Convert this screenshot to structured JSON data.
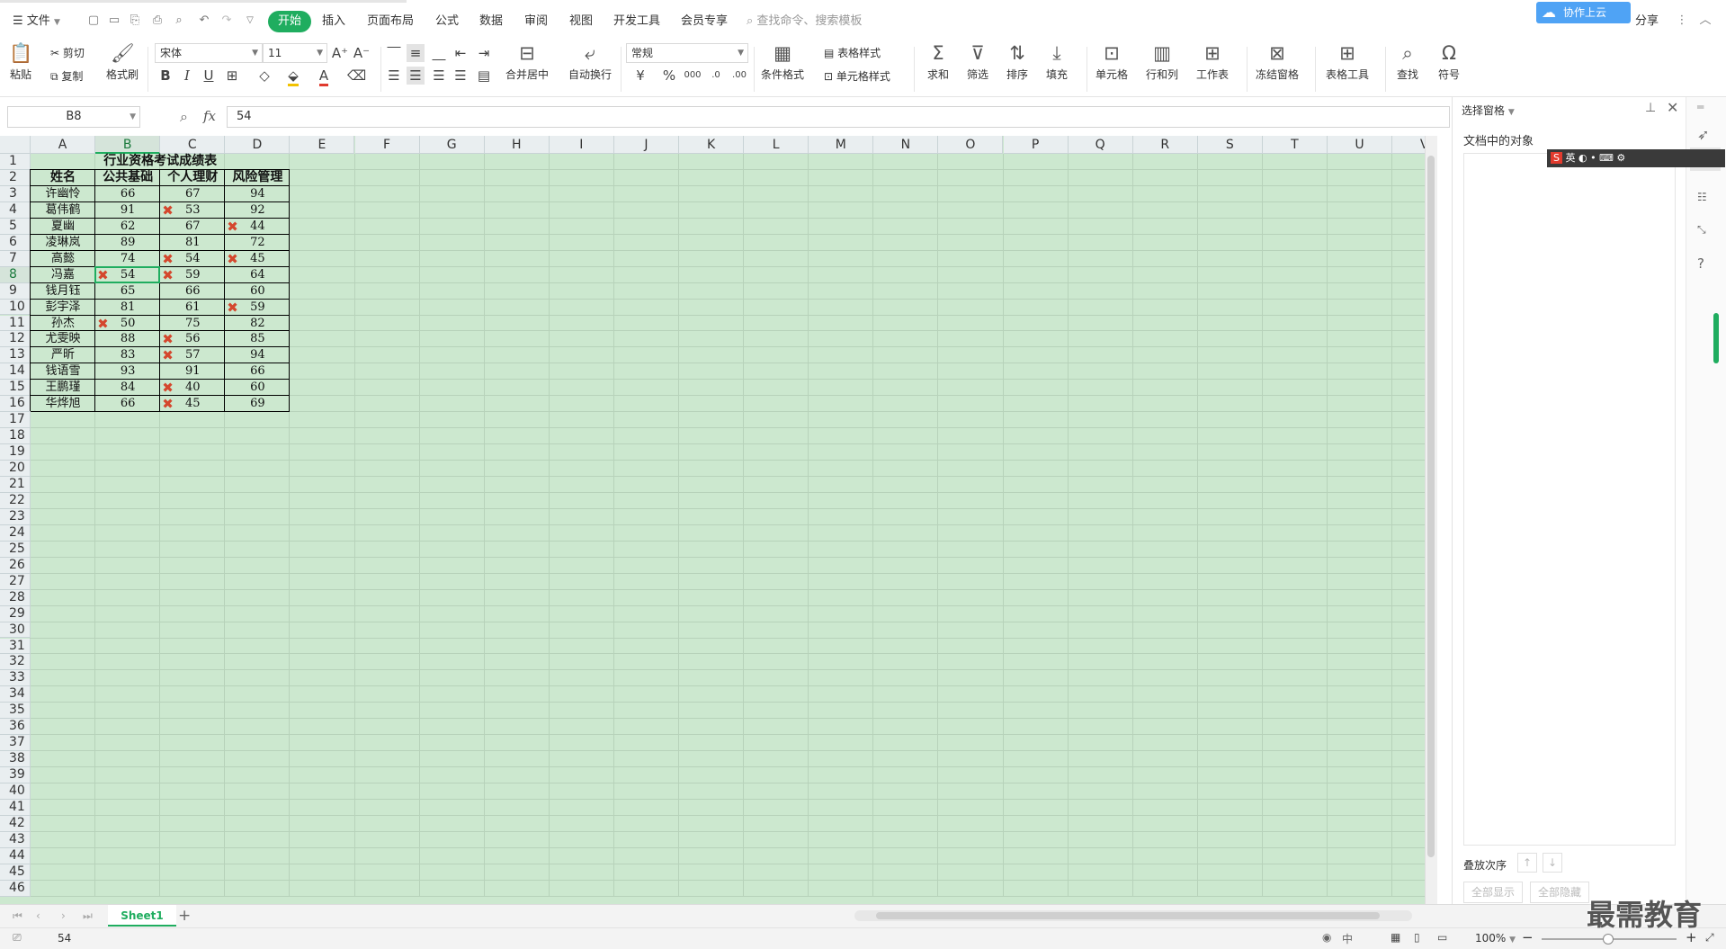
{
  "menu": {
    "file_label": "文件",
    "tabs": [
      {
        "label": "开始",
        "active": true
      },
      {
        "label": "插入"
      },
      {
        "label": "页面布局"
      },
      {
        "label": "公式"
      },
      {
        "label": "数据"
      },
      {
        "label": "审阅"
      },
      {
        "label": "视图"
      },
      {
        "label": "开发工具"
      },
      {
        "label": "会员专享"
      }
    ],
    "search_placeholder": "查找命令、搜索模板",
    "share_label": "分享",
    "cloud_label": "协作上云"
  },
  "ribbon": {
    "paste": "粘贴",
    "cut": "剪切",
    "copy": "复制",
    "format_painter": "格式刷",
    "font_name": "宋体",
    "font_size": "11",
    "merge_center": "合并居中",
    "wrap_text": "自动换行",
    "number_format": "常规",
    "conditional_format": "条件格式",
    "table_style": "表格样式",
    "cell_style": "单元格样式",
    "sum": "求和",
    "filter": "筛选",
    "sort": "排序",
    "fill": "填充",
    "cell": "单元格",
    "row_col": "行和列",
    "worksheet": "工作表",
    "freeze": "冻结窗格",
    "table_tools": "表格工具",
    "find": "查找",
    "symbol": "符号"
  },
  "formula_bar": {
    "name_box": "B8",
    "fx": "fx",
    "value": "54"
  },
  "columns": [
    "A",
    "B",
    "C",
    "D",
    "E",
    "F",
    "G",
    "H",
    "I",
    "J",
    "K",
    "L",
    "M",
    "N",
    "O",
    "P",
    "Q",
    "R",
    "S",
    "T",
    "U",
    "V"
  ],
  "selected_column": "B",
  "selected_row": 8,
  "table": {
    "title": "行业资格考试成绩表",
    "headers": [
      "姓名",
      "公共基础",
      "个人理财",
      "风险管理"
    ],
    "rows": [
      [
        "许幽怜",
        "66",
        "67",
        "94"
      ],
      [
        "葛伟鹤",
        "91",
        "53",
        "92"
      ],
      [
        "夏幽",
        "62",
        "67",
        "44"
      ],
      [
        "凌琳岚",
        "89",
        "81",
        "72"
      ],
      [
        "高懿",
        "74",
        "54",
        "45"
      ],
      [
        "冯嘉",
        "54",
        "59",
        "64"
      ],
      [
        "钱月钰",
        "65",
        "66",
        "60"
      ],
      [
        "彭宇泽",
        "81",
        "61",
        "59"
      ],
      [
        "孙杰",
        "50",
        "75",
        "82"
      ],
      [
        "尤雯映",
        "88",
        "56",
        "85"
      ],
      [
        "严昕",
        "83",
        "57",
        "94"
      ],
      [
        "钱语雪",
        "93",
        "91",
        "66"
      ],
      [
        "王鹏瑾",
        "84",
        "40",
        "60"
      ],
      [
        "华烨旭",
        "66",
        "45",
        "69"
      ]
    ],
    "failed_marks": [
      [
        1,
        2
      ],
      [
        2,
        3
      ],
      [
        4,
        2
      ],
      [
        4,
        3
      ],
      [
        5,
        1
      ],
      [
        5,
        2
      ],
      [
        7,
        3
      ],
      [
        8,
        1
      ],
      [
        9,
        2
      ],
      [
        10,
        2
      ],
      [
        12,
        2
      ],
      [
        13,
        2
      ]
    ]
  },
  "right_pane": {
    "title": "选择窗格",
    "subtitle": "文档中的对象",
    "stack_order": "叠放次序",
    "show_all": "全部显示",
    "hide_all": "全部隐藏"
  },
  "sheet_tabs": [
    {
      "label": "Sheet1",
      "active": true
    }
  ],
  "status": {
    "value": "54",
    "zoom": "100%"
  },
  "watermark": "最需教育",
  "colors": {
    "accent": "#1fad5f",
    "grid_bg": "#cce8cf",
    "fail_mark": "#d4472d"
  }
}
